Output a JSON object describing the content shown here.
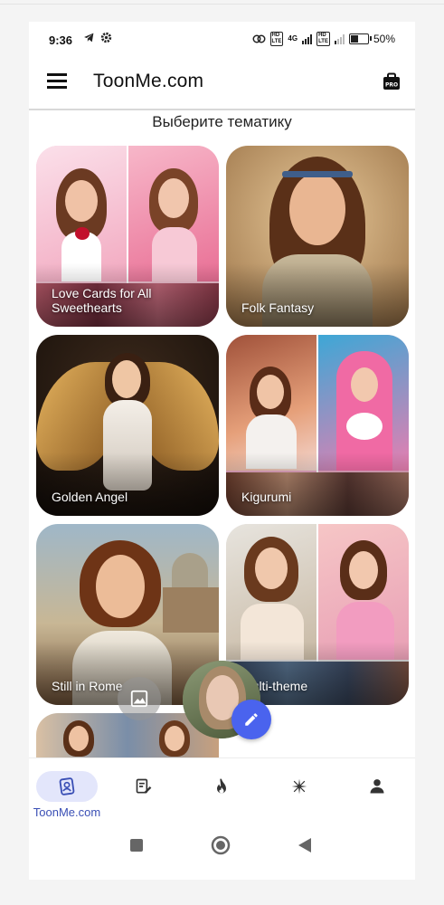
{
  "status_bar": {
    "time": "9:36",
    "battery": "50%",
    "battery_level": 0.5,
    "network_badges": [
      "VoLTE",
      "4G",
      "VoLTE"
    ],
    "left_icons": [
      "telegram-icon",
      "settings-gear-icon"
    ],
    "right_icons": [
      "link-icon",
      "signal-icon",
      "battery-icon"
    ]
  },
  "app_bar": {
    "title": "ToonMe.com",
    "menu_icon": "hamburger-menu-icon",
    "pro_badge": "PRO"
  },
  "section_heading": "Выберите тематику",
  "themes": [
    {
      "label": "Love Cards for All Sweethearts",
      "style": "collage-pink"
    },
    {
      "label": "Folk Fantasy",
      "style": "portrait-folk"
    },
    {
      "label": "Golden Angel",
      "style": "portrait-angel"
    },
    {
      "label": "Kigurumi",
      "style": "collage-kigurumi"
    },
    {
      "label": "Still in Rome",
      "style": "portrait-rome"
    },
    {
      "label": "Multi-theme",
      "style": "collage-multi"
    }
  ],
  "floating": {
    "gallery_icon": "image-gallery-icon",
    "edit_icon": "pencil-icon",
    "avatar": "user-photo"
  },
  "bottom_nav": {
    "items": [
      {
        "label": "ToonMe.com",
        "icon": "toonme-portrait-icon",
        "active": true
      },
      {
        "label": "",
        "icon": "edit-template-icon",
        "active": false
      },
      {
        "label": "",
        "icon": "fire-icon",
        "active": false
      },
      {
        "label": "",
        "icon": "sparkle-icon",
        "active": false
      },
      {
        "label": "",
        "icon": "profile-icon",
        "active": false
      }
    ],
    "accent_color": "#3a4fb5",
    "active_bg": "#e3e6fb"
  },
  "system_nav": [
    "recents-square-icon",
    "home-circle-icon",
    "back-triangle-icon"
  ],
  "colors": {
    "fab": "#4a63ee"
  }
}
